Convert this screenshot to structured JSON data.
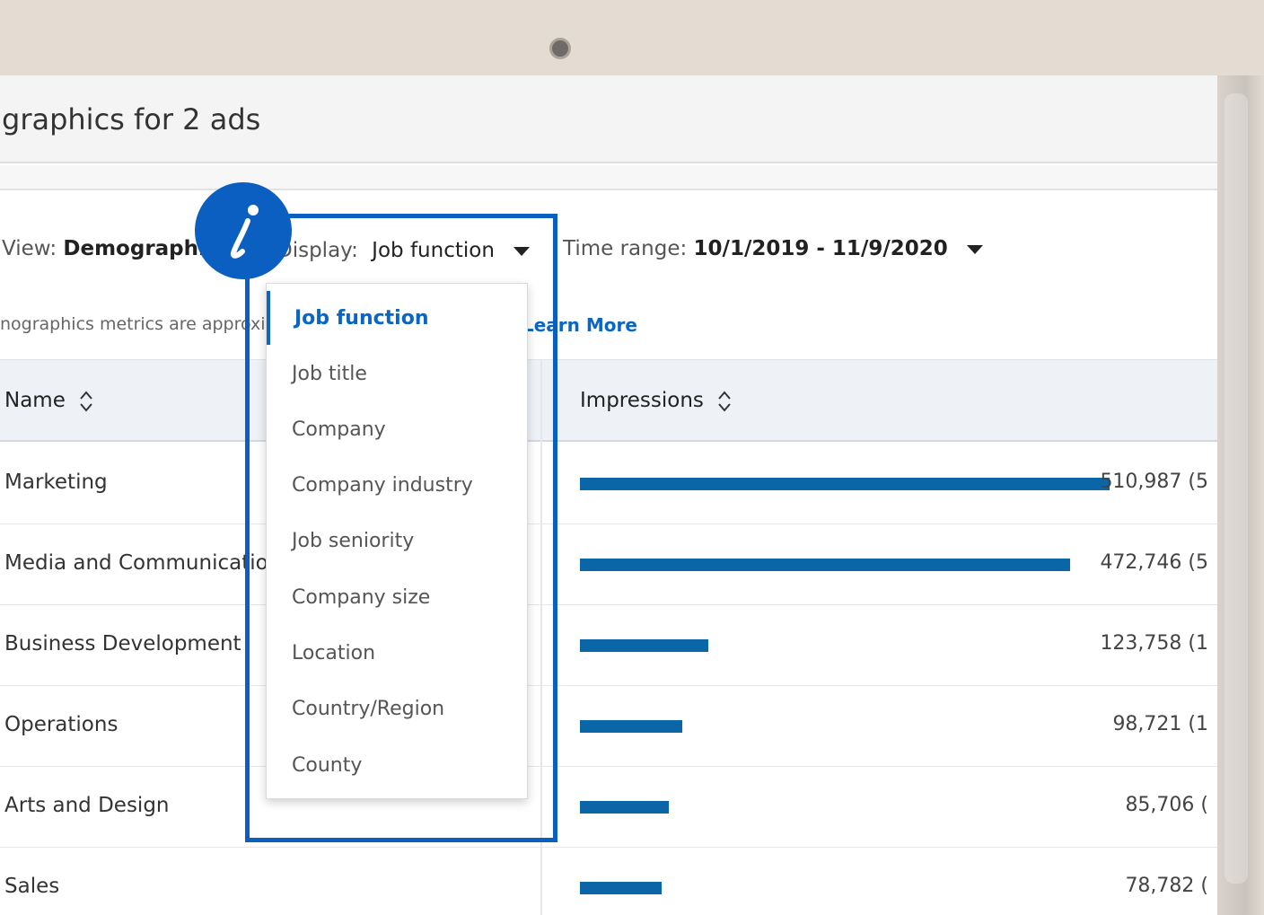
{
  "page": {
    "title": "graphics for 2 ads",
    "note": "nographics metrics are approxim",
    "learn_more": "Learn More"
  },
  "filters": {
    "view_label": "View:",
    "view_value": "Demographics",
    "display_label": "Display:",
    "display_value": "Job function",
    "time_label": "Time range:",
    "time_value": "10/1/2019 - 11/9/2020"
  },
  "table": {
    "headers": {
      "name": "Name",
      "impressions": "Impressions"
    },
    "rows": [
      {
        "name": "Marketing",
        "value": "510,987 (5",
        "bar_fraction": 1.0
      },
      {
        "name": "Media and Communication",
        "value": "472,746 (5",
        "bar_fraction": 0.9251
      },
      {
        "name": "Business Development",
        "value": "123,758 (1",
        "bar_fraction": 0.2422
      },
      {
        "name": "Operations",
        "value": "98,721 (1",
        "bar_fraction": 0.1932
      },
      {
        "name": "Arts and Design",
        "value": "85,706 (",
        "bar_fraction": 0.1677
      },
      {
        "name": "Sales",
        "value": "78,782 (",
        "bar_fraction": 0.1542
      }
    ]
  },
  "dropdown": {
    "items": [
      "Job function",
      "Job title",
      "Company",
      "Company industry",
      "Job seniority",
      "Company size",
      "Location",
      "Country/Region",
      "County"
    ],
    "selected": "Job function"
  },
  "colors": {
    "accent": "#0a66c2",
    "bar": "#0b66a8",
    "highlight": "#0a5fc0"
  },
  "icons": {
    "info": "info-icon",
    "sort": "sort-icon",
    "caret": "caret-down-icon"
  }
}
